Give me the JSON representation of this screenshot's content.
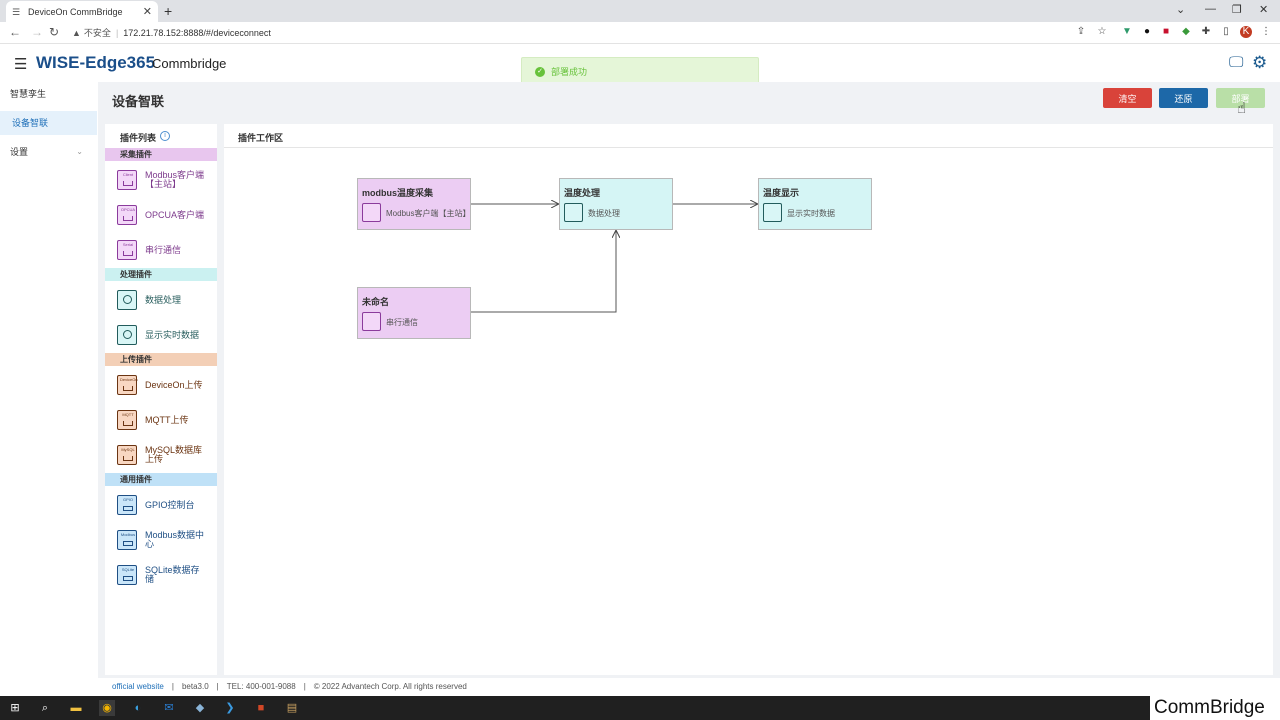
{
  "browser": {
    "tab_title": "DeviceOn CommBridge",
    "new_tab": "+",
    "url_warning": "不安全",
    "url": "172.21.78.152:8888/#/deviceconnect",
    "icons": [
      "back-arrow-icon",
      "forward-arrow-icon",
      "reload-icon",
      "share-icon",
      "star-icon",
      "vue-extension-icon",
      "circle-extension-icon",
      "red-extension-icon",
      "shield-extension-icon",
      "puzzle-icon",
      "sidebar-icon",
      "profile-avatar-icon",
      "menu-kebab-icon"
    ],
    "profile_letter": "K"
  },
  "header": {
    "brand": "WISE-Edge365",
    "product": "Commbridge",
    "toast": "部署成功"
  },
  "nav": {
    "items": [
      {
        "label": "智慧孪生"
      },
      {
        "label": "设备智联"
      },
      {
        "label": "设置"
      }
    ]
  },
  "page": {
    "title": "设备智联",
    "buttons": {
      "clear": "清空",
      "restore": "还原",
      "deploy": "部署"
    }
  },
  "plugins": {
    "title": "插件列表",
    "categories": [
      {
        "label": "采集插件",
        "color": "#e8c6ee"
      },
      {
        "label": "处理插件",
        "color": "#cbf1f1"
      },
      {
        "label": "上传插件",
        "color": "#f3cfb6"
      },
      {
        "label": "通用插件",
        "color": "#bfe1f7"
      }
    ],
    "collect": [
      {
        "label": "Modbus客户端【主站】",
        "icon_text": "Client"
      },
      {
        "label": "OPCUA客户端",
        "icon_text": "OPCUA"
      },
      {
        "label": "串行通信",
        "icon_text": "Serial"
      }
    ],
    "process": [
      {
        "label": "数据处理"
      },
      {
        "label": "显示实时数据"
      }
    ],
    "upload": [
      {
        "label": "DeviceOn上传",
        "icon_text": "DeviceOn"
      },
      {
        "label": "MQTT上传",
        "icon_text": "MQTT"
      },
      {
        "label": "MySQL数据库上传",
        "icon_text": "MySQL"
      }
    ],
    "general": [
      {
        "label": "GPIO控制台",
        "icon_text": "GPIO"
      },
      {
        "label": "Modbus数据中心",
        "icon_text": "Modbus"
      },
      {
        "label": "SQLite数据存储",
        "icon_text": "SQLite"
      }
    ]
  },
  "workspace": {
    "title": "插件工作区",
    "nodes": [
      {
        "title": "modbus温度采集",
        "subtitle": "Modbus客户端【主站】",
        "icon_text": "Client"
      },
      {
        "title": "温度处理",
        "subtitle": "数据处理"
      },
      {
        "title": "温度显示",
        "subtitle": "显示实时数据"
      },
      {
        "title": "未命名",
        "subtitle": "串行通信",
        "icon_text": "Serial"
      }
    ]
  },
  "footer": {
    "link": "official website",
    "version": "beta3.0",
    "tel": "TEL: 400-001-9088",
    "copyright": "© 2022 Advantech Corp. All rights reserved",
    "sep": "|"
  },
  "overlay": {
    "watermark": "CommBridge"
  }
}
